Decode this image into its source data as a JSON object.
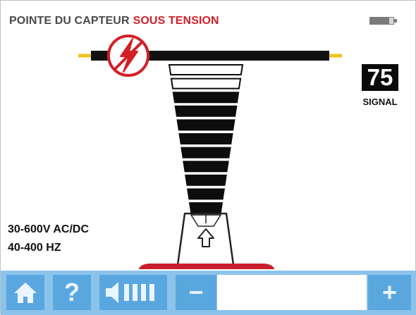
{
  "header": {
    "title_prefix": "POINTE DU CAPTEUR",
    "title_status": "SOUS TENSION"
  },
  "signal": {
    "value": "75",
    "label": "SIGNAL"
  },
  "range": {
    "voltage": "30-600V AC/DC",
    "frequency": "40-400 HZ"
  },
  "meter": {
    "segments_total": 11,
    "segments_active": 9
  },
  "toolbar": {
    "help_label": "?",
    "minus_label": "−",
    "plus_label": "+"
  },
  "icons": {
    "home": "home-icon",
    "volume": "volume-icon",
    "battery": "battery-icon",
    "voltage": "lightning-icon",
    "up_arrow": "up-arrow-icon"
  },
  "colors": {
    "alert_red": "#d21f26",
    "toolbar_bg": "#8cc3ea",
    "button_bg": "#5aa7e0",
    "wire_yellow": "#f2c21b"
  }
}
